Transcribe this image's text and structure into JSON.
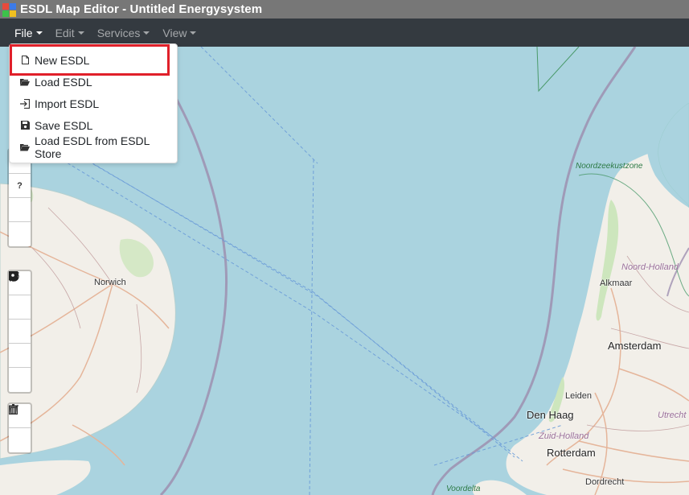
{
  "window": {
    "title": "ESDL Map Editor - Untitled Energysystem",
    "icon": "esdl-app-icon"
  },
  "menubar": {
    "items": [
      {
        "label": "File",
        "active": true
      },
      {
        "label": "Edit",
        "active": false
      },
      {
        "label": "Services",
        "active": false
      },
      {
        "label": "View",
        "active": false
      }
    ]
  },
  "file_menu": {
    "items": [
      {
        "label": "New ESDL",
        "icon": "file-icon",
        "highlighted": true
      },
      {
        "label": "Load ESDL",
        "icon": "folder-open-icon"
      },
      {
        "label": "Import ESDL",
        "icon": "import-icon"
      },
      {
        "label": "Save ESDL",
        "icon": "save-icon"
      },
      {
        "label": "Load ESDL from ESDL Store",
        "icon": "folder-open-icon"
      }
    ],
    "highlight_color": "#e0202a"
  },
  "toolbar": {
    "group1": [
      "table-icon",
      "help-icon",
      "play-circle-icon",
      "grid-icon"
    ],
    "group1_help_glyph": "?",
    "group2": [
      "draw-polyline-icon",
      "draw-polygon-icon",
      "draw-rectangle-icon",
      "draw-marker-icon",
      "draw-circle-icon"
    ],
    "group3": [
      "edit-layers-icon",
      "delete-layers-icon"
    ]
  },
  "map": {
    "labels": {
      "norwich": "Norwich",
      "noordzeekustzone": "Noordzeekustzone",
      "noord_holland": "Noord-Holland",
      "alkmaar": "Alkmaar",
      "amsterdam": "Amsterdam",
      "leiden": "Leiden",
      "den_haag": "Den Haag",
      "zuid_holland": "Zuid-Holland",
      "utrecht": "Utrecht",
      "rotterdam": "Rotterdam",
      "voordelta": "Voordelta",
      "dordrecht": "Dordrecht"
    },
    "colors": {
      "sea": "#aad3df",
      "land": "#f2efe9",
      "border": "#9e8fb0"
    }
  }
}
